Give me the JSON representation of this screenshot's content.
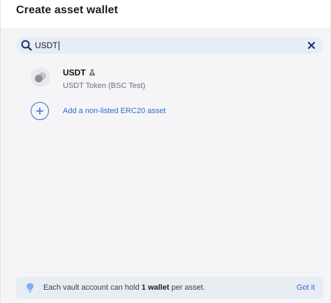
{
  "header": {
    "title": "Create asset wallet"
  },
  "search": {
    "value": "USDT"
  },
  "results": [
    {
      "symbol": "USDT",
      "name": "USDT Token (BSC Test)",
      "badge_icon": "testnet-flask-icon"
    }
  ],
  "add_asset": {
    "label": "Add a non-listed ERC20 asset"
  },
  "footer": {
    "text_before": "Each vault account can hold ",
    "text_bold": "1 wallet",
    "text_after": " per asset.",
    "action_label": "Got it"
  },
  "colors": {
    "accent": "#2f6bd1",
    "search_bg": "#e6edf7",
    "footer_bg": "#e8edf4",
    "bulb": "#7fb0ea"
  }
}
